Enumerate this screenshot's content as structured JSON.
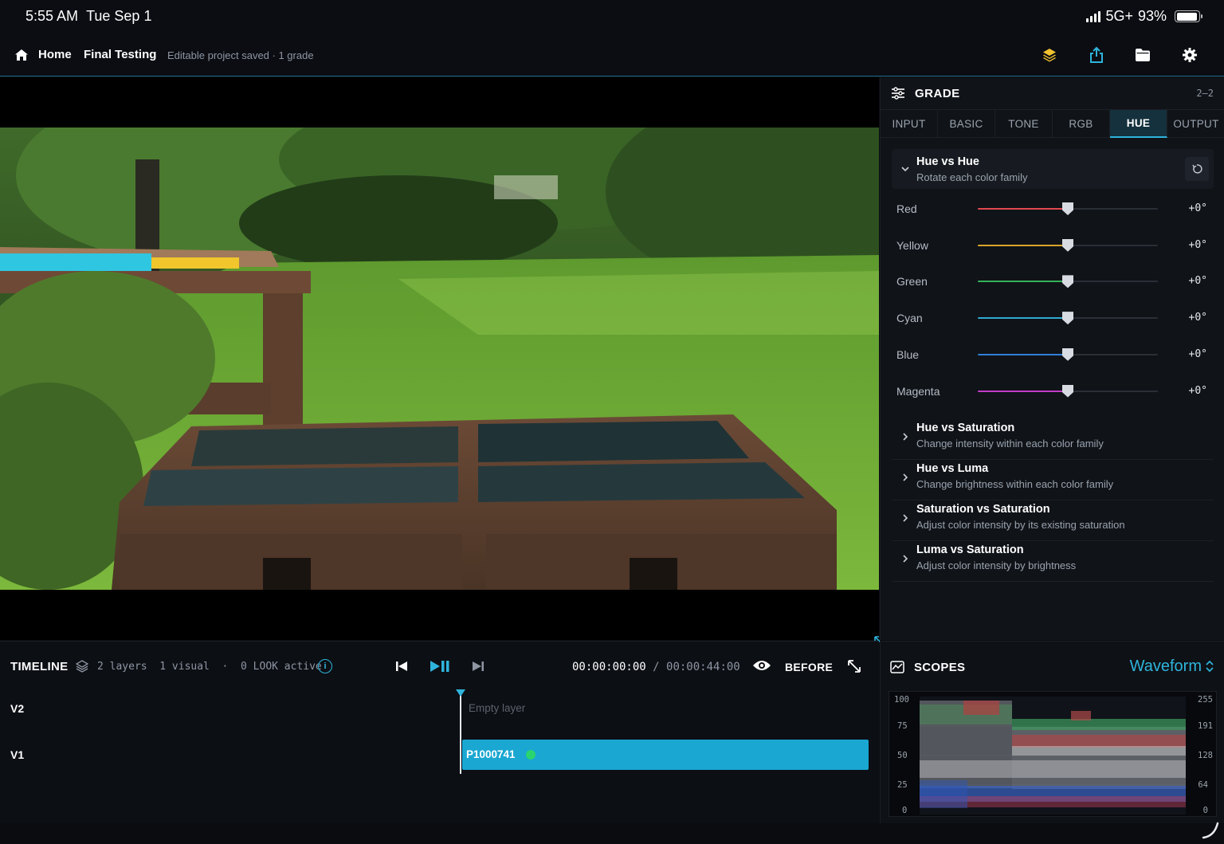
{
  "status_bar": {
    "time": "5:55 AM",
    "date": "Tue Sep 1",
    "network": "5G+",
    "battery": "93%",
    "battery_level": 0.93
  },
  "nav": {
    "home": "Home",
    "project_title": "Final Testing",
    "project_status": "Editable project saved · 1 grade",
    "icons": [
      "layers-icon",
      "share-icon",
      "folder-icon",
      "settings-gear-icon"
    ]
  },
  "grade": {
    "title": "GRADE",
    "range": "2–2",
    "tabs": [
      {
        "label": "INPUT",
        "active": false
      },
      {
        "label": "BASIC",
        "active": false
      },
      {
        "label": "TONE",
        "active": false
      },
      {
        "label": "RGB",
        "active": false
      },
      {
        "label": "HUE",
        "active": true
      },
      {
        "label": "OUTPUT",
        "active": false
      }
    ],
    "hue_vs_hue": {
      "title": "Hue vs Hue",
      "subtitle": "Rotate each color family",
      "sliders": [
        {
          "label": "Red",
          "value": "+0°",
          "position": 0.5,
          "color": "#e0484d"
        },
        {
          "label": "Yellow",
          "value": "+0°",
          "position": 0.5,
          "color": "#d9a52b"
        },
        {
          "label": "Green",
          "value": "+0°",
          "position": 0.5,
          "color": "#34b25a"
        },
        {
          "label": "Cyan",
          "value": "+0°",
          "position": 0.5,
          "color": "#2fa9cf"
        },
        {
          "label": "Blue",
          "value": "+0°",
          "position": 0.5,
          "color": "#2f7ed8"
        },
        {
          "label": "Magenta",
          "value": "+0°",
          "position": 0.5,
          "color": "#c43bc9"
        }
      ]
    },
    "sections": [
      {
        "title": "Hue vs Saturation",
        "subtitle": "Change intensity within each color family"
      },
      {
        "title": "Hue vs Luma",
        "subtitle": "Change brightness within each color family"
      },
      {
        "title": "Saturation vs Saturation",
        "subtitle": "Adjust color intensity by its existing saturation"
      },
      {
        "title": "Luma vs Saturation",
        "subtitle": "Adjust color intensity by brightness"
      }
    ]
  },
  "timeline": {
    "title": "TIMELINE",
    "meta": "2 layers  1 visual  ·  0 LOOK active",
    "timecode_current": "00:00:00:00",
    "timecode_sep": " / ",
    "timecode_total": "00:00:44:00",
    "before_label": "BEFORE",
    "tracks": [
      {
        "label": "V2",
        "content": "Empty layer"
      },
      {
        "label": "V1",
        "clip": "P1000741"
      }
    ]
  },
  "scopes": {
    "title": "SCOPES",
    "mode": "Waveform",
    "left_axis": [
      "100",
      "75",
      "50",
      "25",
      "0"
    ],
    "right_axis": [
      "255",
      "191",
      "128",
      "64",
      "0"
    ]
  },
  "colors": {
    "accent": "#2fb4dc",
    "clip": "#1aa7d2",
    "status_dot": "#2ad46f",
    "panel": "#101318"
  }
}
